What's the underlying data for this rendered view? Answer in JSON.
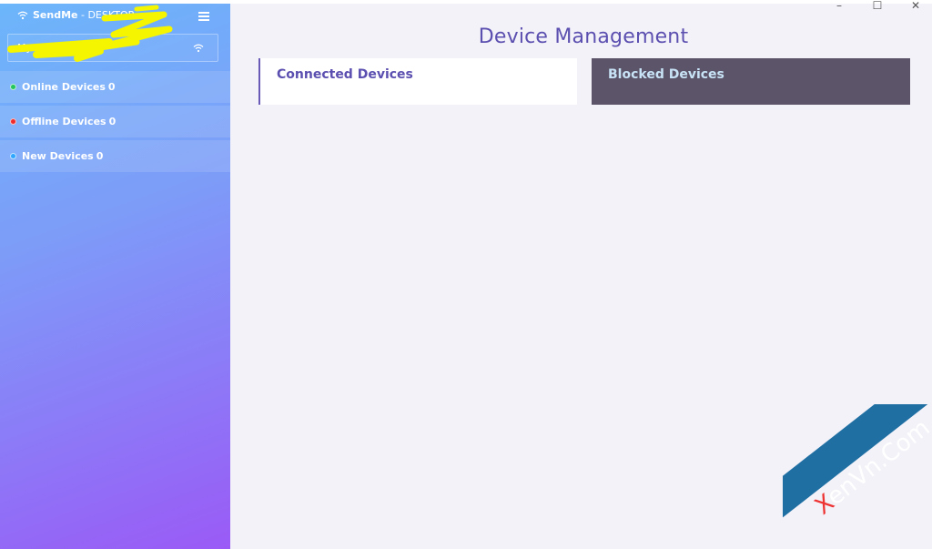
{
  "app": {
    "title": "SendMe",
    "host": " - DESKTOP"
  },
  "sidebar": {
    "network": {
      "name": "My Network"
    },
    "items": [
      {
        "label": "Online Devices",
        "count": "0",
        "color": "#22c55e"
      },
      {
        "label": "Offline Devices",
        "count": "0",
        "color": "#ef2b2b"
      },
      {
        "label": "New Devices",
        "count": "0",
        "color": "#2fa6ff"
      }
    ]
  },
  "main": {
    "title": "Device Management",
    "tabs": [
      {
        "label": "Connected Devices"
      },
      {
        "label": "Blocked Devices"
      }
    ]
  },
  "window_controls": {
    "minimize": "–",
    "maximize": "☐",
    "close": "✕"
  },
  "watermark": {
    "brand": "enVn.Com",
    "mark": "X"
  },
  "colors": {
    "accent": "#5b4fb0",
    "blocked_tab": "#5c5469",
    "scribble": "#f5f500"
  }
}
